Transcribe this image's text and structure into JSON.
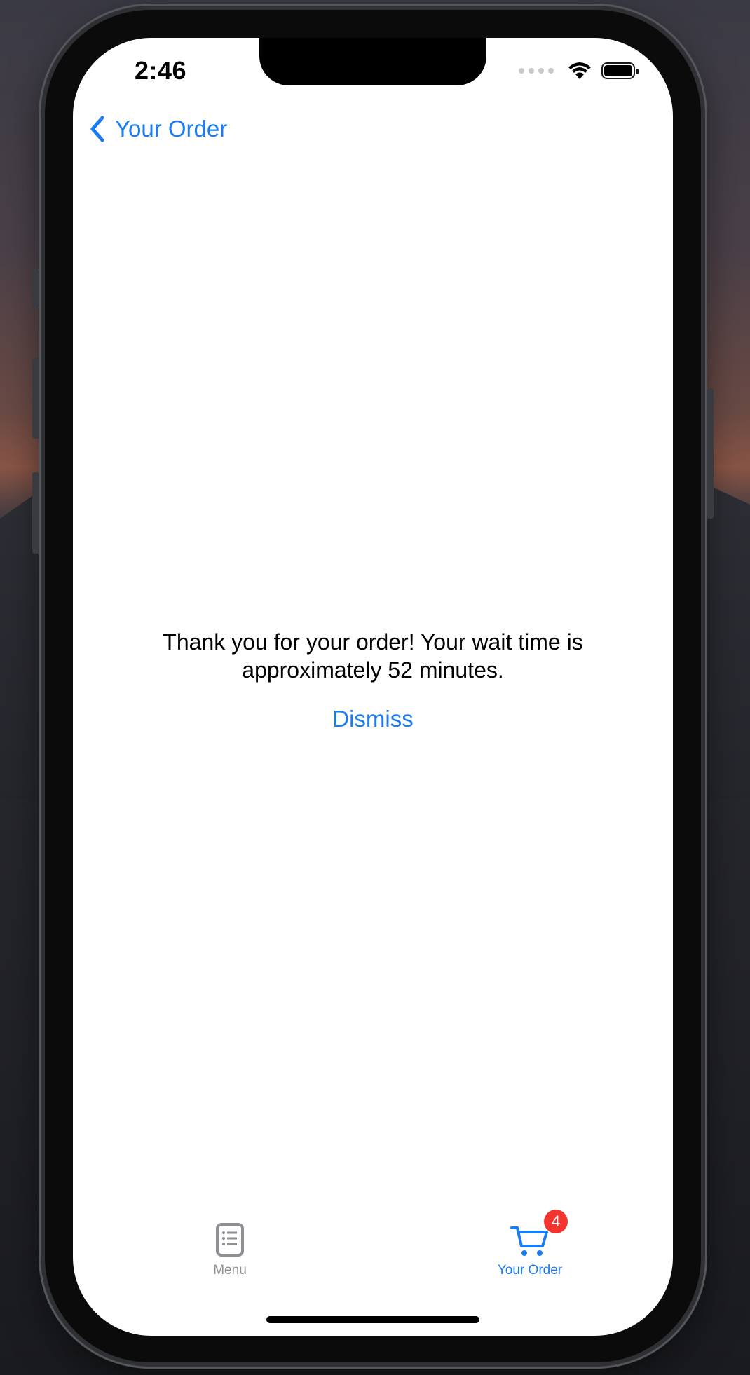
{
  "status_bar": {
    "time": "2:46"
  },
  "nav": {
    "back_label": "Your Order",
    "back_icon": "chevron-left-icon"
  },
  "message": {
    "text": "Thank you for your order! Your wait time is approximately 52 minutes."
  },
  "dismiss": {
    "label": "Dismiss"
  },
  "tab_bar": {
    "tabs": [
      {
        "label": "Menu",
        "icon": "list-document-icon",
        "selected": false
      },
      {
        "label": "Your Order",
        "icon": "cart-icon",
        "selected": true,
        "badge": "4"
      }
    ]
  },
  "colors": {
    "accent": "#1a7cf0",
    "badge": "#f2362f",
    "inactive_tab": "#8e8e93"
  }
}
